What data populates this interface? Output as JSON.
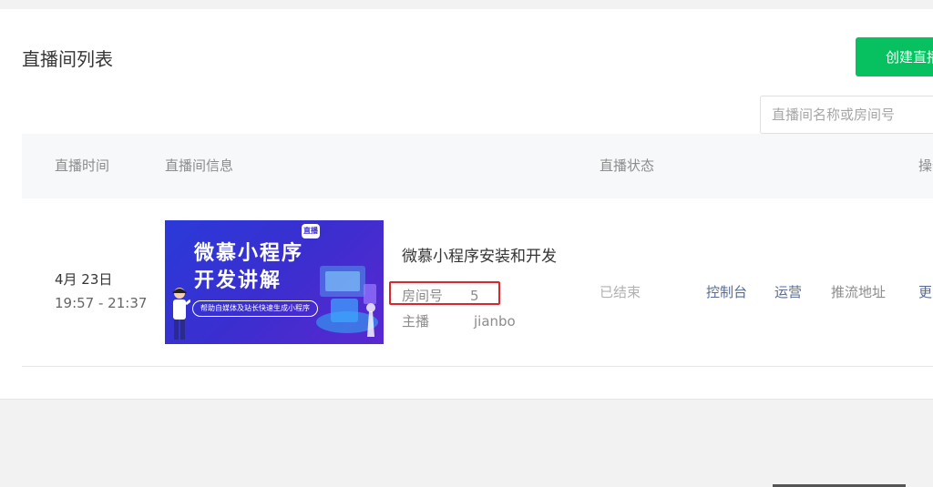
{
  "page": {
    "title": "直播间列表",
    "create_button": "创建直播间",
    "search_placeholder": "直播间名称或房间号"
  },
  "table": {
    "headers": {
      "time": "直播时间",
      "info": "直播间信息",
      "status": "直播状态",
      "actions": "操作"
    },
    "rows": [
      {
        "date": "4月 23日",
        "time": "19:57 - 21:37",
        "cover": {
          "title_line1": "微慕小程序",
          "title_line2": "开发讲解",
          "subtitle": "帮助自媒体及站长快速生成小程序",
          "badge": "直播"
        },
        "name": "微慕小程序安装和开发",
        "room_label": "房间号",
        "room_number": "5",
        "anchor_label": "主播",
        "anchor_name": "jianbo",
        "status": "已结束",
        "actions": {
          "console": "控制台",
          "operate": "运营",
          "push_url": "推流地址",
          "more": "更多"
        }
      }
    ]
  },
  "colors": {
    "primary_green": "#07c160",
    "link_blue": "#576b95",
    "highlight_red": "#e0242b"
  }
}
